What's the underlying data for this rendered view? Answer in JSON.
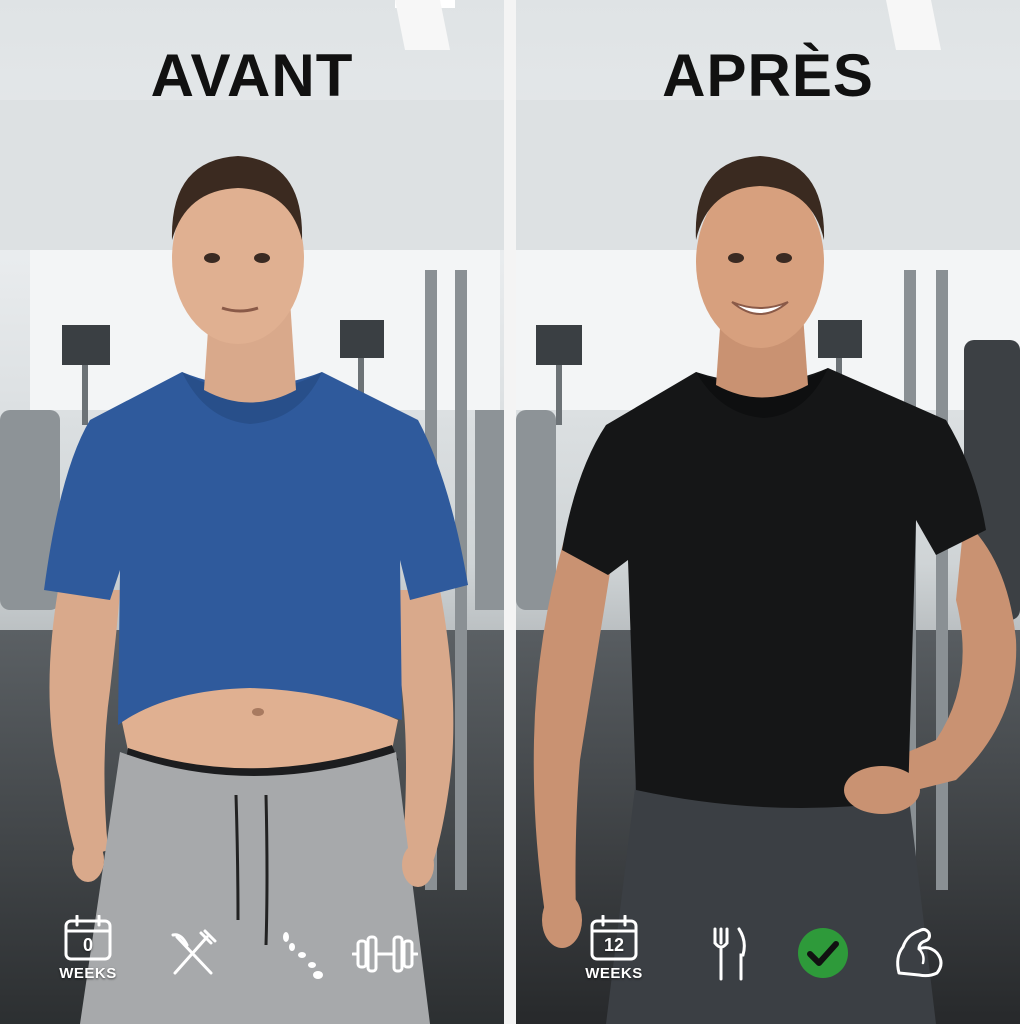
{
  "before": {
    "title": "AVANT",
    "weeks_value": "0",
    "weeks_label": "WEEKS",
    "icons": [
      "calendar-icon",
      "crossed-fork-knife-icon",
      "footprints-icon",
      "dumbbell-icon"
    ]
  },
  "after": {
    "title": "APRÈS",
    "weeks_value": "12",
    "weeks_label": "WEEKS",
    "icons": [
      "calendar-icon",
      "fork-knife-icon",
      "checkmark-icon",
      "flexed-bicep-icon"
    ]
  },
  "colors": {
    "before_shirt": "#2f5a9c",
    "after_shirt": "#151617",
    "check_green": "#2e9a3a",
    "title_text": "#111111"
  }
}
